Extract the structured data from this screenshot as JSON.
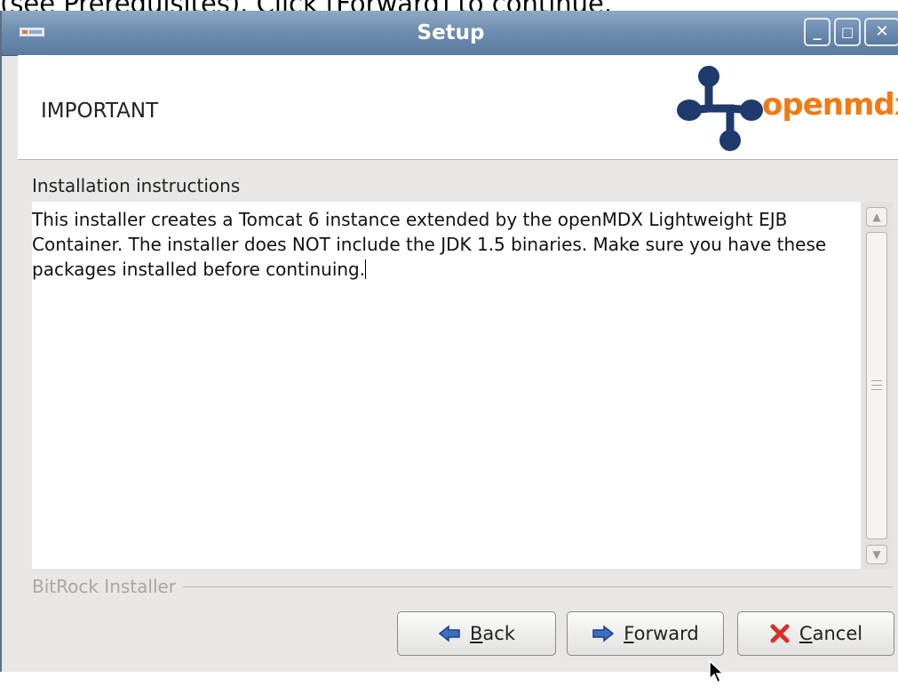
{
  "background": {
    "caption": "(see Prerequisites). Click [Forward] to continue."
  },
  "window": {
    "title": "Setup",
    "controls": {
      "minimize": "_",
      "maximize": "□",
      "close": "✕"
    }
  },
  "header": {
    "title": "IMPORTANT",
    "logo_text": "openmdx"
  },
  "content": {
    "section_label": "Installation instructions",
    "text": "This installer creates a Tomcat 6 instance extended by the openMDX Lightweight EJB Container. The installer does NOT include the JDK 1.5 binaries. Make sure you have these packages installed before continuing."
  },
  "scrollbar": {
    "up_arrow": "▲",
    "down_arrow": "▼"
  },
  "footer": {
    "brand": "BitRock Installer"
  },
  "buttons": {
    "back": {
      "mnemonic": "B",
      "rest": "ack",
      "icon": "arrow-left-icon"
    },
    "forward": {
      "mnemonic": "F",
      "rest": "orward",
      "icon": "arrow-right-icon"
    },
    "cancel": {
      "mnemonic": "C",
      "rest": "ancel",
      "icon": "cross-icon"
    }
  },
  "colors": {
    "titlebar": "#6f8eb1",
    "window_bg": "#e8e7e6",
    "logo_blue": "#1f3a6d",
    "logo_orange": "#f07a14",
    "cancel_red": "#d8302a",
    "arrow_blue": "#3a6fc4"
  }
}
